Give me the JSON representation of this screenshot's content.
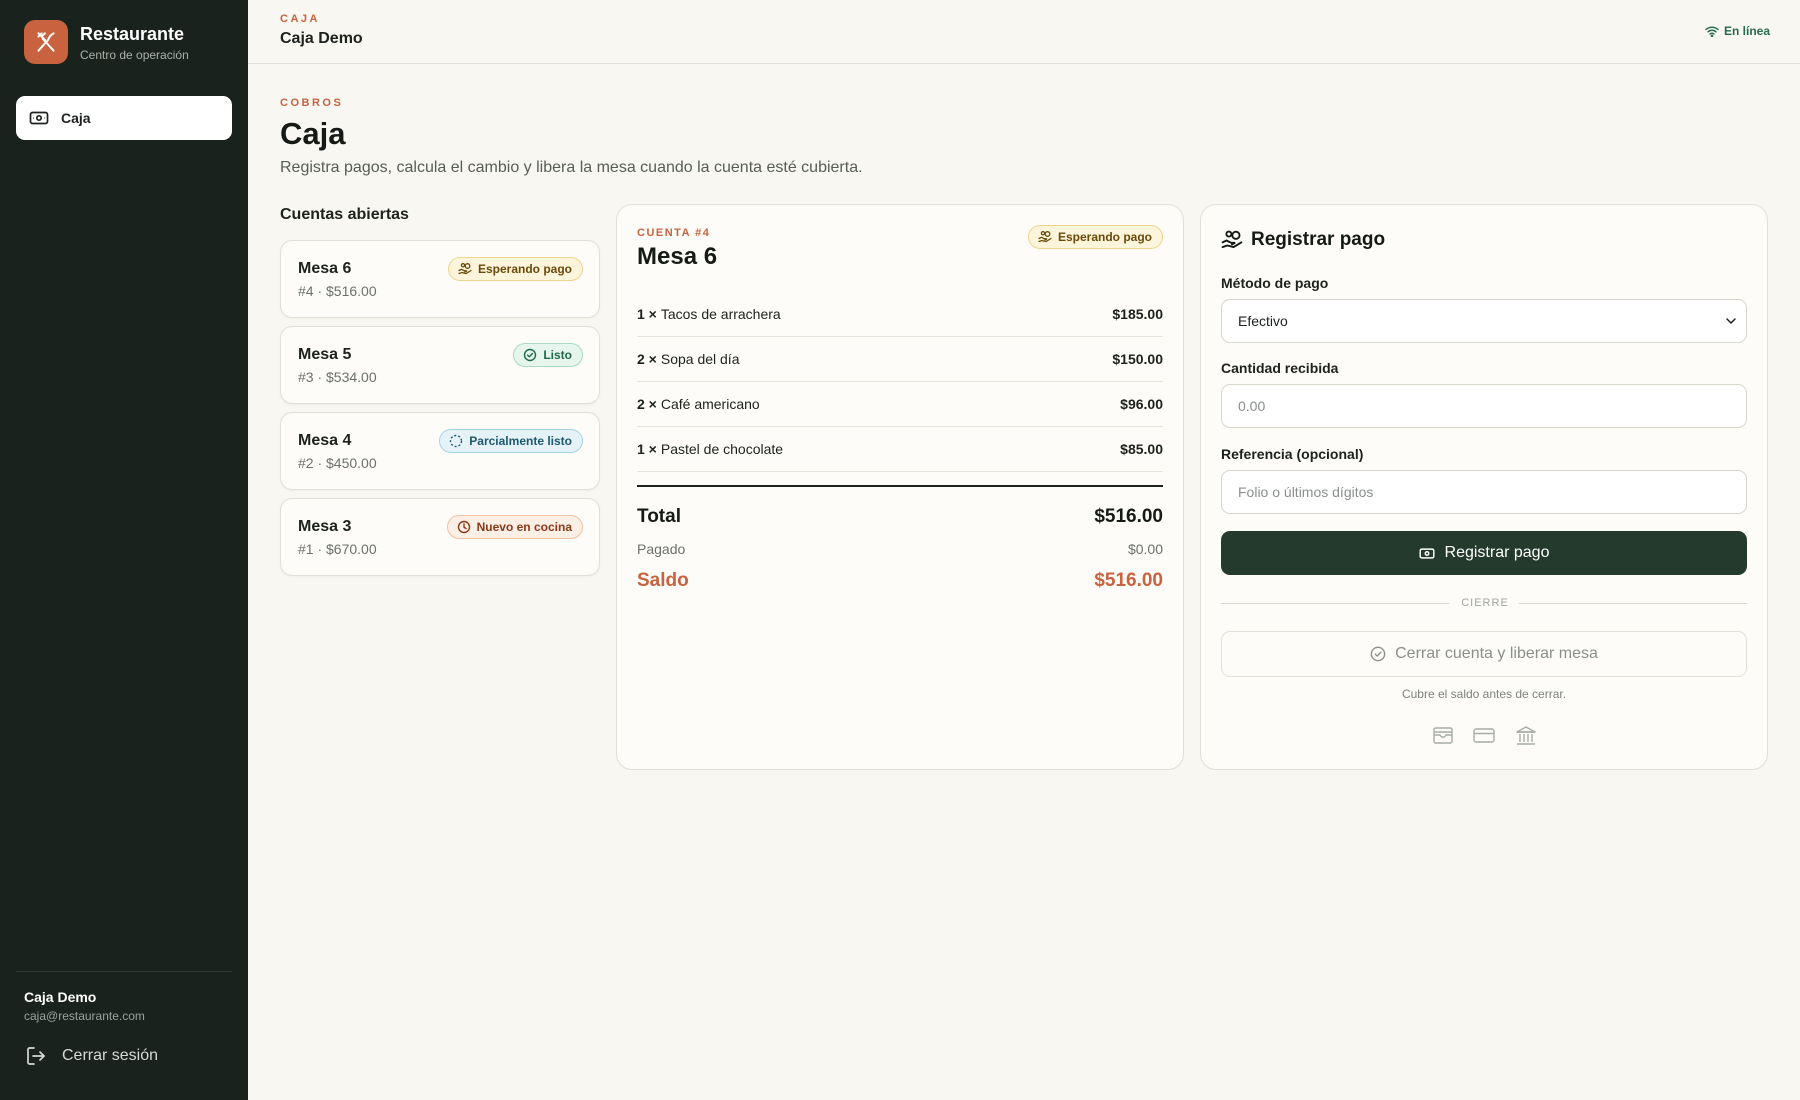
{
  "brand": {
    "title": "Restaurante",
    "subtitle": "Centro de operación"
  },
  "sidebar": {
    "items": [
      {
        "label": "Caja",
        "icon": "cash-icon",
        "active": true
      }
    ],
    "user": {
      "name": "Caja Demo",
      "email": "caja@restaurante.com"
    },
    "logout_label": "Cerrar sesión"
  },
  "topbar": {
    "eyebrow": "CAJA",
    "title": "Caja Demo",
    "status": "En línea"
  },
  "header": {
    "eyebrow": "COBROS",
    "title": "Caja",
    "subtitle": "Registra pagos, calcula el cambio y libera la mesa cuando la cuenta esté cubierta."
  },
  "accounts": {
    "title": "Cuentas abiertas",
    "items": [
      {
        "name": "Mesa 6",
        "meta": "#4 · $516.00",
        "status": "Esperando pago"
      },
      {
        "name": "Mesa 5",
        "meta": "#3 · $534.00",
        "status": "Listo"
      },
      {
        "name": "Mesa 4",
        "meta": "#2 · $450.00",
        "status": "Parcialmente listo"
      },
      {
        "name": "Mesa 3",
        "meta": "#1 · $670.00",
        "status": "Nuevo en cocina"
      }
    ]
  },
  "detail": {
    "eyebrow": "CUENTA #4",
    "title": "Mesa 6",
    "status": "Esperando pago",
    "lines": [
      {
        "qty": "1 ×",
        "name": "Tacos de arrachera",
        "amount": "$185.00"
      },
      {
        "qty": "2 ×",
        "name": "Sopa del día",
        "amount": "$150.00"
      },
      {
        "qty": "2 ×",
        "name": "Café americano",
        "amount": "$96.00"
      },
      {
        "qty": "1 ×",
        "name": "Pastel de chocolate",
        "amount": "$85.00"
      }
    ],
    "total_label": "Total",
    "total": "$516.00",
    "paid_label": "Pagado",
    "paid": "$0.00",
    "balance_label": "Saldo",
    "balance": "$516.00"
  },
  "payment": {
    "title": "Registrar pago",
    "method_label": "Método de pago",
    "method_value": "Efectivo",
    "amount_label": "Cantidad recibida",
    "amount_placeholder": "0.00",
    "reference_label": "Referencia (opcional)",
    "reference_placeholder": "Folio o últimos dígitos",
    "submit_label": "Registrar pago",
    "divider_label": "CIERRE",
    "close_label": "Cerrar cuenta y liberar mesa",
    "hint": "Cubre el saldo antes de cerrar."
  },
  "colors": {
    "accent": "#c8623f",
    "sidebar": "#19221c",
    "primary_button": "#243a2d"
  }
}
